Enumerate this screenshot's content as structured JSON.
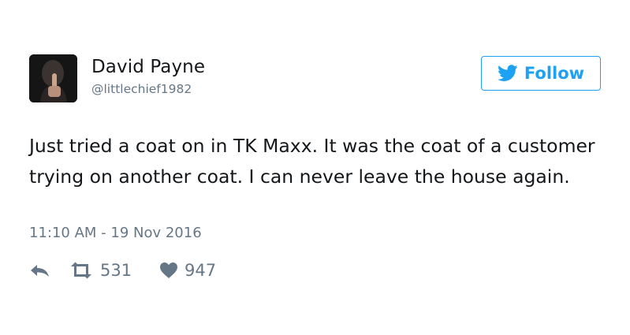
{
  "user": {
    "name": "David Payne",
    "handle": "@littlechief1982"
  },
  "follow_button": {
    "label": "Follow"
  },
  "tweet": {
    "text": "Just tried a coat on in TK Maxx. It was the coat of a customer trying on another coat. I can never leave the house again.",
    "timestamp": "11:10 AM - 19 Nov 2016"
  },
  "actions": {
    "retweet_count": "531",
    "like_count": "947"
  },
  "colors": {
    "accent": "#1da1f2",
    "muted": "#657786",
    "text": "#14171a"
  },
  "icons": {
    "reply": "reply-icon",
    "retweet": "retweet-icon",
    "like": "heart-icon",
    "brand": "twitter-bird-icon"
  }
}
